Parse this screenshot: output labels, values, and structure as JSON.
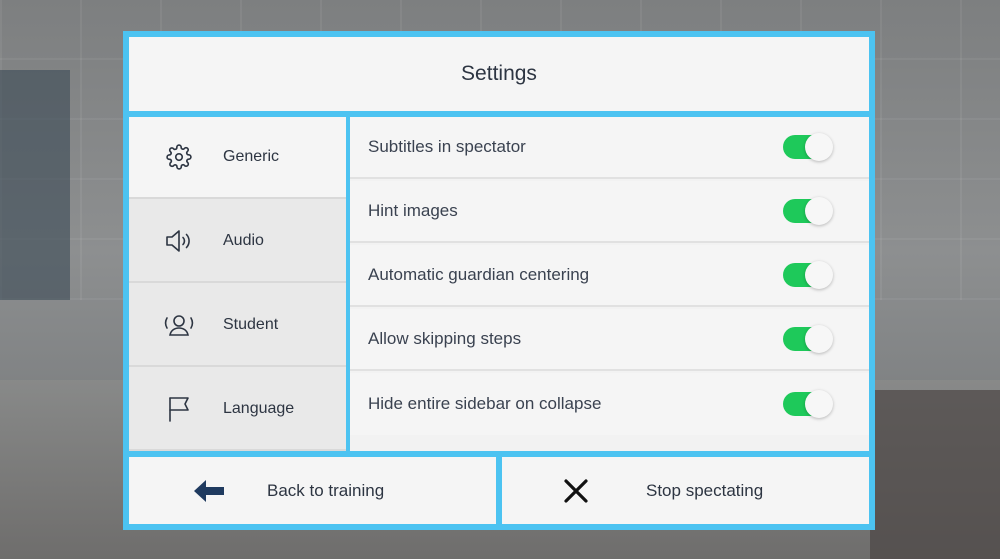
{
  "header": {
    "title": "Settings"
  },
  "sidebar": {
    "items": [
      {
        "label": "Generic",
        "icon": "gear-icon",
        "active": true
      },
      {
        "label": "Audio",
        "icon": "speaker-icon",
        "active": false
      },
      {
        "label": "Student",
        "icon": "user-icon",
        "active": false
      },
      {
        "label": "Language",
        "icon": "flag-icon",
        "active": false
      }
    ]
  },
  "settings": {
    "rows": [
      {
        "label": "Subtitles in spectator",
        "enabled": true
      },
      {
        "label": "Hint images",
        "enabled": true
      },
      {
        "label": "Automatic guardian centering",
        "enabled": true
      },
      {
        "label": "Allow skipping steps",
        "enabled": true
      },
      {
        "label": "Hide entire sidebar on collapse",
        "enabled": true
      }
    ]
  },
  "footer": {
    "back_label": "Back to training",
    "back_icon": "arrow-left-icon",
    "stop_label": "Stop spectating",
    "stop_icon": "close-icon"
  },
  "colors": {
    "frame": "#4cc3f1",
    "toggle_on": "#1ec95a",
    "text": "#2d3542",
    "panel": "#f5f5f5"
  }
}
